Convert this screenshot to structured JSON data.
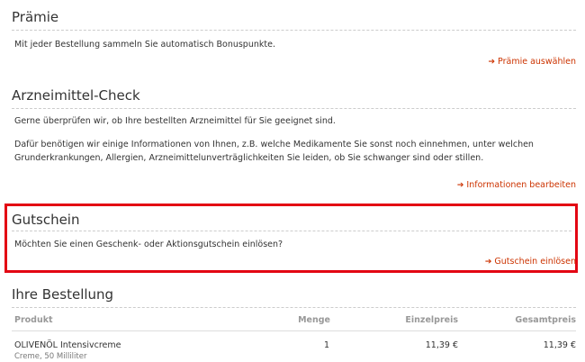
{
  "praemie": {
    "title": "Prämie",
    "text": "Mit jeder Bestellung sammeln Sie automatisch Bonuspunkte.",
    "link": "Prämie auswählen"
  },
  "check": {
    "title": "Arzneimittel-Check",
    "text1": "Gerne überprüfen wir, ob Ihre bestellten Arzneimittel für Sie geeignet sind.",
    "text2_line1": "Dafür benötigen wir einige Informationen von Ihnen, z.B. welche Medikamente Sie sonst noch einnehmen, unter welchen",
    "text2_line2": "Grunderkrankungen, Allergien, Arzneimittelunverträglichkeiten Sie leiden, ob Sie schwanger sind oder stillen.",
    "link": "Informationen bearbeiten"
  },
  "gutschein": {
    "title": "Gutschein",
    "text": "Möchten Sie einen Geschenk- oder Aktionsgutschein einlösen?",
    "link": "Gutschein einlösen"
  },
  "order": {
    "title": "Ihre Bestellung",
    "headers": {
      "product": "Produkt",
      "qty": "Menge",
      "unit": "Einzelpreis",
      "total": "Gesamtpreis"
    },
    "item": {
      "name": "OLIVENÖL Intensivcreme",
      "sub": "Creme, 50 Milliliter",
      "qty": "1",
      "unit": "11,39 €",
      "total": "11,39 €"
    }
  },
  "colors": {
    "link": "#cc3300",
    "highlight": "#e30613"
  }
}
